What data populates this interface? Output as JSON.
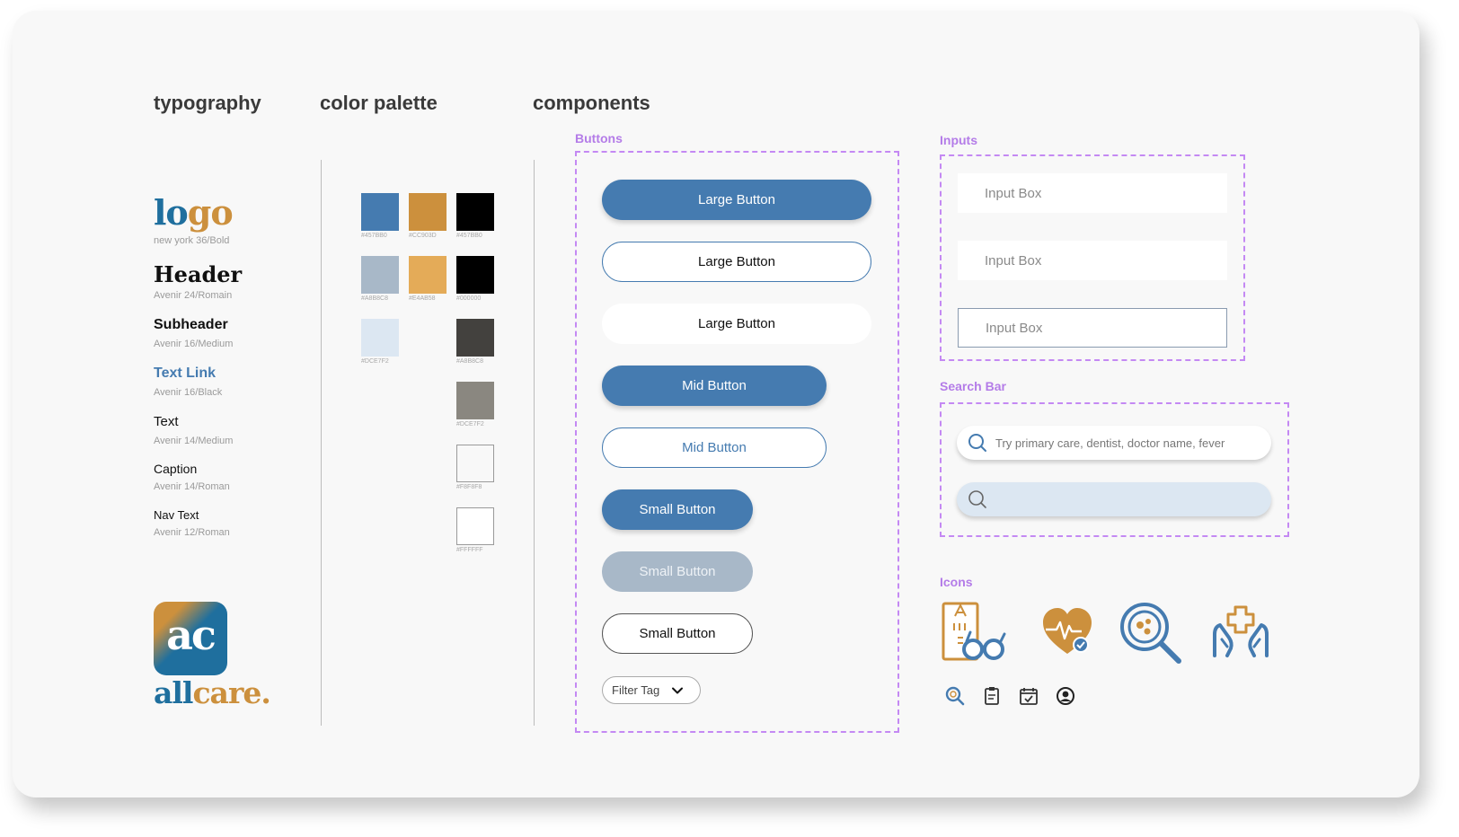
{
  "sections": {
    "typography": "typography",
    "color_palette": "color palette",
    "components": "components"
  },
  "typography": {
    "logo_part1": "lo",
    "logo_part2": "go",
    "logo_spec": "new york 36/Bold",
    "header": "Header",
    "header_spec": "Avenir 24/Romain",
    "subheader": "Subheader",
    "subheader_spec": "Avenir 16/Medium",
    "text_link": "Text Link",
    "text_link_spec": "Avenir 16/Black",
    "text": "Text",
    "text_spec": "Avenir 14/Medium",
    "caption": "Caption",
    "caption_spec": "Avenir 14/Roman",
    "nav_text": "Nav Text",
    "nav_text_spec": "Avenir 12/Roman",
    "app_icon_letters": "ac",
    "wordmark_part1": "all",
    "wordmark_part2": "care."
  },
  "palette": {
    "swatches": [
      {
        "color": "#457BB0",
        "label": "#457BB0"
      },
      {
        "color": "#CC903D",
        "label": "#CC903D"
      },
      {
        "color": "#000000",
        "label": "#457BB0"
      },
      {
        "color": "#A8B8C8",
        "label": "#A8B8C8"
      },
      {
        "color": "#E4AB58",
        "label": "#E4AB58"
      },
      {
        "color": "#000000",
        "label": "#000000"
      },
      {
        "color": "#DCE7F2",
        "label": "#DCE7F2"
      },
      {
        "color": "#43413E",
        "label": "#A8B8C8"
      },
      {
        "color": "#8A8780",
        "label": "#DCE7F2"
      },
      {
        "color": "#F8F8F8",
        "label": "#F8F8F8"
      },
      {
        "color": "#FFFFFF",
        "label": "#FFFFFF"
      }
    ]
  },
  "components": {
    "buttons_label": "Buttons",
    "inputs_label": "Inputs",
    "search_label": "Search Bar",
    "icons_label": "Icons",
    "large_button": "Large Button",
    "mid_button": "Mid Button",
    "small_button": "Small Button",
    "filter_tag": "Filter Tag",
    "input_box": "Input Box",
    "search_placeholder": "Try primary care, dentist, doctor name, fever"
  },
  "colors": {
    "primary": "#457BB0",
    "accent": "#CC903D",
    "accent_light": "#E4AB58",
    "label_purple": "#B47CE8"
  },
  "icons": [
    "eye-chart-glasses-icon",
    "heart-pulse-check-icon",
    "magnifier-cells-icon",
    "hands-care-icon",
    "search-icon",
    "clipboard-icon",
    "calendar-check-icon",
    "user-circle-icon"
  ]
}
